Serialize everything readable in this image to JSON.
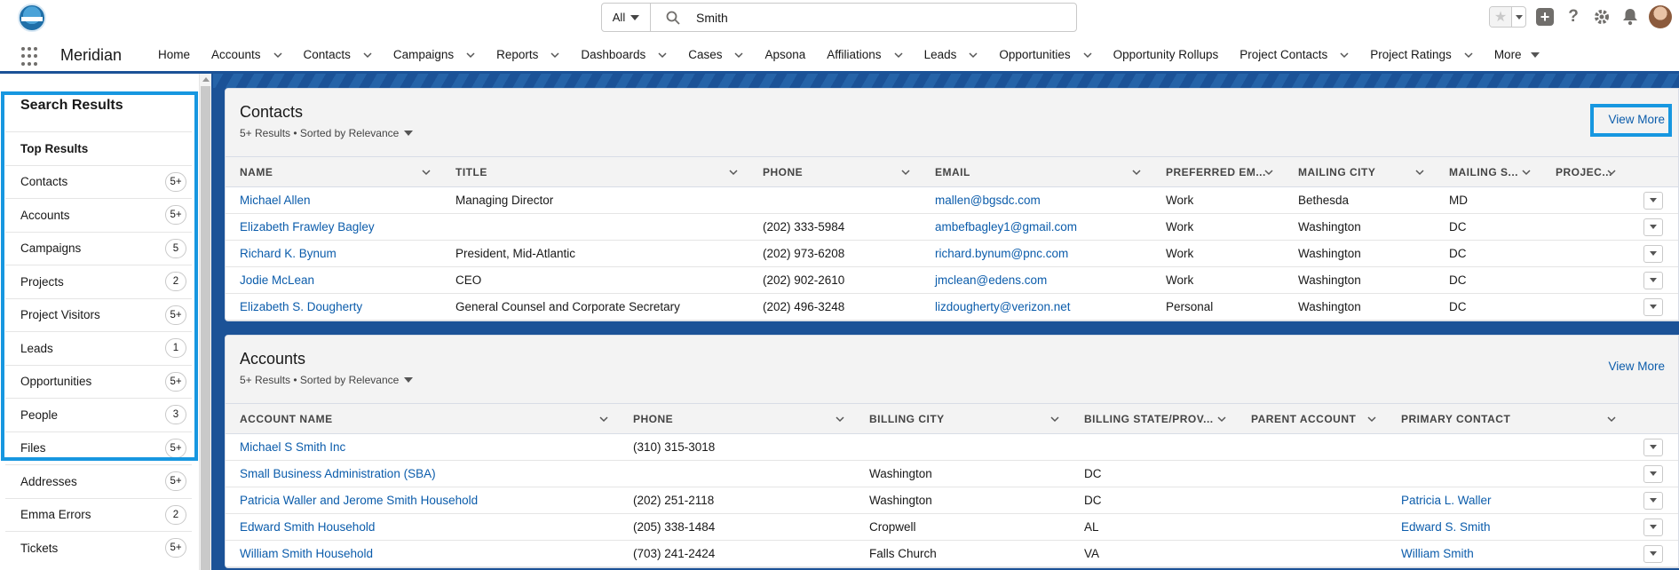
{
  "header": {
    "search": {
      "scope": "All",
      "query": "Smith"
    },
    "tools": {
      "favorites": "star-icon",
      "add": "plus-icon",
      "help": "?",
      "setup": "gear-icon",
      "notifications": "bell-icon"
    }
  },
  "nav": {
    "app_name": "Meridian",
    "items": [
      {
        "label": "Home",
        "dropdown": false
      },
      {
        "label": "Accounts",
        "dropdown": true
      },
      {
        "label": "Contacts",
        "dropdown": true
      },
      {
        "label": "Campaigns",
        "dropdown": true
      },
      {
        "label": "Reports",
        "dropdown": true
      },
      {
        "label": "Dashboards",
        "dropdown": true
      },
      {
        "label": "Cases",
        "dropdown": true
      },
      {
        "label": "Apsona",
        "dropdown": false
      },
      {
        "label": "Affiliations",
        "dropdown": true
      },
      {
        "label": "Leads",
        "dropdown": true
      },
      {
        "label": "Opportunities",
        "dropdown": true
      },
      {
        "label": "Opportunity Rollups",
        "dropdown": false
      },
      {
        "label": "Project Contacts",
        "dropdown": true
      },
      {
        "label": "Project Ratings",
        "dropdown": true
      },
      {
        "label": "More",
        "dropdown": true
      }
    ]
  },
  "sidebar": {
    "title": "Search Results",
    "items": [
      {
        "label": "Top Results",
        "badge": ""
      },
      {
        "label": "Contacts",
        "badge": "5+"
      },
      {
        "label": "Accounts",
        "badge": "5+"
      },
      {
        "label": "Campaigns",
        "badge": "5"
      },
      {
        "label": "Projects",
        "badge": "2"
      },
      {
        "label": "Project Visitors",
        "badge": "5+"
      },
      {
        "label": "Leads",
        "badge": "1"
      },
      {
        "label": "Opportunities",
        "badge": "5+"
      },
      {
        "label": "People",
        "badge": "3"
      },
      {
        "label": "Files",
        "badge": "5+"
      },
      {
        "label": "Addresses",
        "badge": "5+"
      },
      {
        "label": "Emma Errors",
        "badge": "2"
      },
      {
        "label": "Tickets",
        "badge": "5+"
      }
    ]
  },
  "contacts": {
    "title": "Contacts",
    "subtitle": "5+ Results • Sorted by Relevance",
    "view_more": "View More",
    "columns": [
      "NAME",
      "TITLE",
      "PHONE",
      "EMAIL",
      "PREFERRED EM...",
      "MAILING CITY",
      "MAILING S...",
      "PROJEC..."
    ],
    "rows": [
      [
        "Michael Allen",
        "Managing Director",
        "",
        "mallen@bgsdc.com",
        "Work",
        "Bethesda",
        "MD",
        ""
      ],
      [
        "Elizabeth Frawley Bagley",
        "",
        "(202) 333-5984",
        "ambefbagley1@gmail.com",
        "Work",
        "Washington",
        "DC",
        ""
      ],
      [
        "Richard K. Bynum",
        "President, Mid-Atlantic",
        "(202) 973-6208",
        "richard.bynum@pnc.com",
        "Work",
        "Washington",
        "DC",
        ""
      ],
      [
        "Jodie McLean",
        "CEO",
        "(202) 902-2610",
        "jmclean@edens.com",
        "Work",
        "Washington",
        "DC",
        ""
      ],
      [
        "Elizabeth S. Dougherty",
        "General Counsel and Corporate Secretary",
        "(202) 496-3248",
        "lizdougherty@verizon.net",
        "Personal",
        "Washington",
        "DC",
        ""
      ]
    ]
  },
  "accounts": {
    "title": "Accounts",
    "subtitle": "5+ Results • Sorted by Relevance",
    "view_more": "View More",
    "columns": [
      "ACCOUNT NAME",
      "PHONE",
      "BILLING CITY",
      "BILLING STATE/PROV...",
      "PARENT ACCOUNT",
      "PRIMARY CONTACT"
    ],
    "rows": [
      [
        "Michael S Smith Inc",
        "(310) 315-3018",
        "",
        "",
        "",
        ""
      ],
      [
        "Small Business Administration (SBA)",
        "",
        "Washington",
        "DC",
        "",
        ""
      ],
      [
        "Patricia Waller and Jerome Smith Household",
        "(202) 251-2118",
        "Washington",
        "DC",
        "",
        "Patricia L. Waller"
      ],
      [
        "Edward Smith Household",
        "(205) 338-1484",
        "Cropwell",
        "AL",
        "",
        "Edward S. Smith"
      ],
      [
        "William Smith Household",
        "(703) 241-2424",
        "Falls Church",
        "VA",
        "",
        "William Smith"
      ]
    ]
  },
  "colors": {
    "brand": "#1b5297",
    "highlight": "#1797e0",
    "link": "#0b5cab"
  }
}
